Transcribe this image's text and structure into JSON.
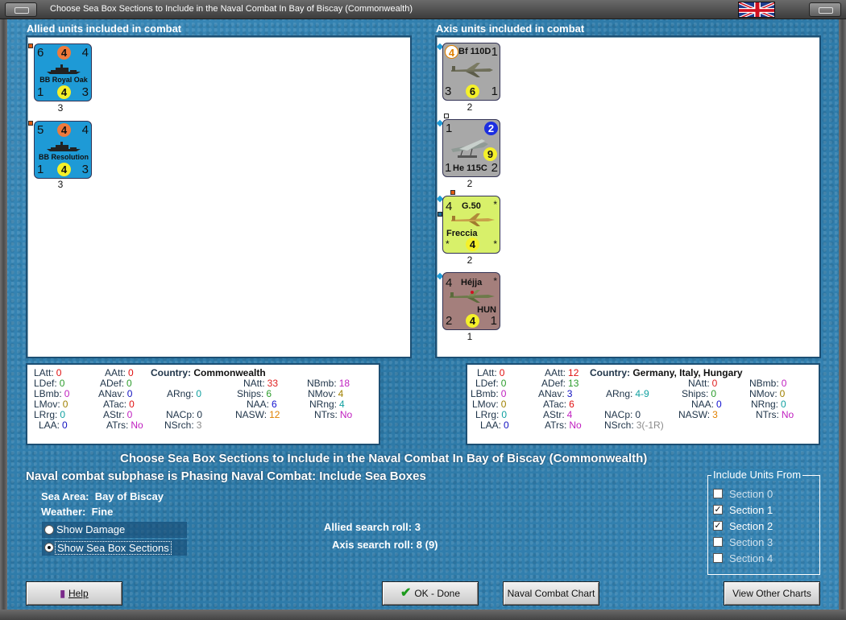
{
  "window": {
    "title": "Choose Sea Box Sections to Include in the Naval Combat In Bay of Biscay (Commonwealth)",
    "flag_icon": "union-jack-flag-icon"
  },
  "allied": {
    "heading": "Allied units included in combat",
    "units": [
      {
        "tl": "6",
        "tc": "4",
        "tr": "4",
        "name": "BB Royal Oak",
        "bl": "1",
        "bc": "4",
        "br": "3",
        "below": "3",
        "color": "#1e9ad6"
      },
      {
        "tl": "5",
        "tc": "4",
        "tr": "4",
        "name": "BB Resolution",
        "bl": "1",
        "bc": "4",
        "br": "3",
        "below": "3",
        "color": "#1e9ad6"
      }
    ],
    "stats": {
      "latt": "0",
      "ldef": "0",
      "lbmb": "0",
      "lmov": "0",
      "lrng": "0",
      "laa": "0",
      "aatt": "0",
      "adef": "0",
      "anav": "0",
      "atac": "0",
      "astr": "0",
      "atrs": "No",
      "country_label": "Country:",
      "country": "Commonwealth",
      "arng": "0",
      "nacp": "0",
      "nsrch": "3",
      "natt": "33",
      "ships": "6",
      "naa": "6",
      "nasw": "12",
      "nbmb": "18",
      "nmov": "4",
      "nrng": "4",
      "ntrs": "No"
    }
  },
  "axis": {
    "heading": "Axis units included in combat",
    "units": [
      {
        "tl": "4",
        "name": "Bf 110D",
        "tr": "1",
        "bl": "3",
        "bc": "6",
        "br": "1",
        "below": "2",
        "color": "#a8a8a8"
      },
      {
        "tl": "1",
        "tr": "2",
        "mr": "9",
        "name": "He 115C",
        "bl": "1",
        "br": "2",
        "below": "2",
        "color": "#a8a8a8"
      },
      {
        "tl": "4",
        "name": "G.50",
        "name2": "Freccia",
        "tr": "*",
        "bl": "*",
        "bc": "4",
        "br": "*",
        "below": "2",
        "color": "#d8f06a"
      },
      {
        "tl": "4",
        "name": "Héjja",
        "name2": "HUN",
        "tr": "*",
        "bl": "2",
        "bc": "4",
        "br": "1",
        "below": "1",
        "color": "#a47f7c"
      }
    ],
    "stats": {
      "latt": "0",
      "ldef": "0",
      "lbmb": "0",
      "lmov": "0",
      "lrng": "0",
      "laa": "0",
      "aatt": "12",
      "adef": "13",
      "anav": "3",
      "atac": "6",
      "astr": "4",
      "atrs": "No",
      "country_label": "Country:",
      "country": "Germany, Italy, Hungary",
      "arng": "4-9",
      "nacp": "0",
      "nsrch": "3(-1R)",
      "natt": "0",
      "ships": "0",
      "naa": "0",
      "nasw": "3",
      "nbmb": "0",
      "nmov": "0",
      "nrng": "0",
      "ntrs": "No"
    }
  },
  "stat_labels": {
    "latt": "LAtt:",
    "ldef": "LDef:",
    "lbmb": "LBmb:",
    "lmov": "LMov:",
    "lrng": "LRrg:",
    "laa": "LAA:",
    "aatt": "AAtt:",
    "adef": "ADef:",
    "anav": "ANav:",
    "atac": "ATac:",
    "astr": "AStr:",
    "atrs": "ATrs:",
    "arng": "ARng:",
    "nacp": "NACp:",
    "nsrch": "NSrch:",
    "natt": "NAtt:",
    "ships": "Ships:",
    "naa": "NAA:",
    "nasw": "NASW:",
    "nbmb": "NBmb:",
    "nmov": "NMov:",
    "nrng": "NRng:",
    "ntrs": "NTrs:"
  },
  "main": {
    "heading": "Choose Sea Box Sections to Include in the Naval Combat In Bay of Biscay (Commonwealth)",
    "subphase": "Naval combat subphase is Phasing Naval Combat: Include Sea Boxes",
    "sea_area_label": "Sea Area:",
    "sea_area": "Bay of Biscay",
    "weather_label": "Weather:",
    "weather": "Fine",
    "allied_roll_label": "Allied search roll:",
    "allied_roll": "3",
    "axis_roll_label": "Axis search roll:",
    "axis_roll": "8 (9)"
  },
  "display_options": [
    {
      "label": "Show Damage",
      "selected": false
    },
    {
      "label": "Show Sea Box Sections",
      "selected": true
    }
  ],
  "include_units": {
    "legend": "Include Units From",
    "sections": [
      {
        "label": "Section 0",
        "checked": false,
        "mark": ""
      },
      {
        "label": "Section 1",
        "checked": true,
        "mark": "✓"
      },
      {
        "label": "Section 2",
        "checked": true,
        "mark": "✓"
      },
      {
        "label": "Section 3",
        "checked": false,
        "mark": ""
      },
      {
        "label": "Section 4",
        "checked": false,
        "mark": ""
      }
    ]
  },
  "buttons": {
    "help": "Help",
    "ok": "OK - Done",
    "chart": "Naval Combat Chart",
    "other": "View Other Charts"
  },
  "colors": {
    "red": "#e01010",
    "green": "#2c9c2c",
    "blue": "#1010c0",
    "purple": "#c020c0",
    "cyan": "#10a0a0",
    "orange": "#e08000",
    "gray": "#8a8a8a",
    "brown": "#a08000",
    "olive": "#8a8a00",
    "navy": "#1010d0",
    "naval_red": "#e02020"
  }
}
